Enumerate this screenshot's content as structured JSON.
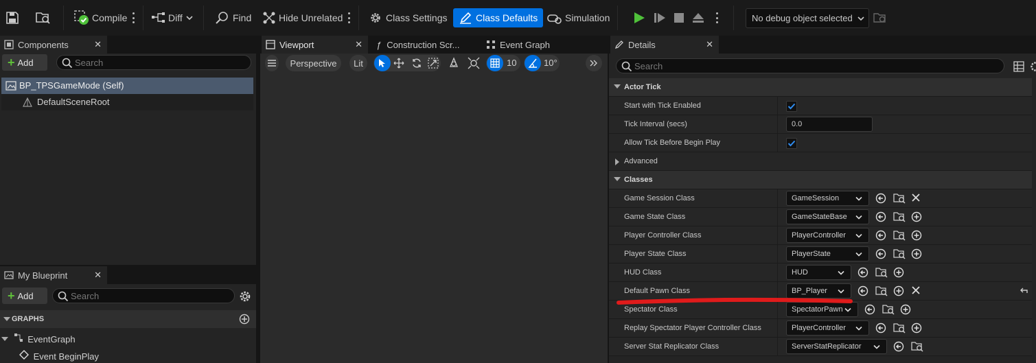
{
  "toolbar": {
    "compile_label": "Compile",
    "diff_label": "Diff",
    "find_label": "Find",
    "hide_unrelated_label": "Hide Unrelated",
    "class_settings_label": "Class Settings",
    "class_defaults_label": "Class Defaults",
    "simulation_label": "Simulation",
    "debug_object": "No debug object selected"
  },
  "components": {
    "tab_label": "Components",
    "add_label": "Add",
    "search_placeholder": "Search",
    "items": [
      "BP_TPSGameMode (Self)",
      "DefaultSceneRoot"
    ]
  },
  "my_blueprint": {
    "tab_label": "My Blueprint",
    "add_label": "Add",
    "search_placeholder": "Search",
    "graphs_header": "GRAPHS",
    "graph_items": [
      "EventGraph",
      "Event BeginPlay"
    ]
  },
  "center_tabs": {
    "viewport": "Viewport",
    "construction": "Construction Scr...",
    "event_graph": "Event Graph"
  },
  "viewport": {
    "perspective": "Perspective",
    "lit": "Lit",
    "grid_value": "10",
    "angle_value": "10°"
  },
  "details": {
    "tab_label": "Details",
    "search_placeholder": "Search",
    "actor_tick": {
      "header": "Actor Tick",
      "start_with_tick_label": "Start with Tick Enabled",
      "start_with_tick_checked": true,
      "tick_interval_label": "Tick Interval (secs)",
      "tick_interval_value": "0.0",
      "allow_tick_label": "Allow Tick Before Begin Play",
      "allow_tick_checked": true,
      "advanced_label": "Advanced"
    },
    "classes": {
      "header": "Classes",
      "rows": [
        {
          "label": "Game Session Class",
          "value": "GameSession"
        },
        {
          "label": "Game State Class",
          "value": "GameStateBase"
        },
        {
          "label": "Player Controller Class",
          "value": "PlayerController"
        },
        {
          "label": "Player State Class",
          "value": "PlayerState"
        },
        {
          "label": "HUD Class",
          "value": "HUD"
        },
        {
          "label": "Default Pawn Class",
          "value": "BP_Player"
        },
        {
          "label": "Spectator Class",
          "value": "SpectatorPawn"
        },
        {
          "label": "Replay Spectator Player Controller Class",
          "value": "PlayerController"
        },
        {
          "label": "Server Stat Replicator Class",
          "value": "ServerStatReplicator"
        }
      ]
    }
  },
  "colors": {
    "accent_blue": "#0070e0",
    "annotation_red": "#e01b1b",
    "play_green": "#4fc13a"
  }
}
